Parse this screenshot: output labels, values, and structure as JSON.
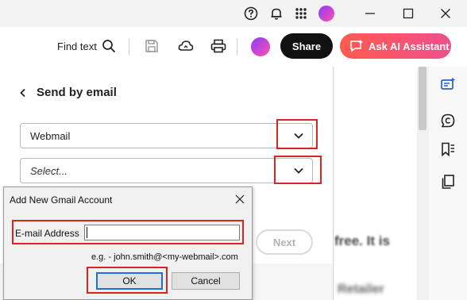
{
  "titlebar": {
    "icons": [
      "help-icon",
      "bell-icon",
      "apps-grid-icon",
      "avatar",
      "minimize-icon",
      "maximize-icon",
      "close-icon"
    ]
  },
  "toolbar": {
    "find_label": "Find text",
    "share_label": "Share",
    "ai_label": "Ask AI Assistant",
    "icons": [
      "search-icon",
      "save-icon",
      "cloud-icon",
      "print-icon"
    ],
    "colors": {
      "share_bg": "#111111",
      "ai_gradient_start": "#ff5a4e",
      "ai_gradient_end": "#ee4f8c"
    }
  },
  "panel": {
    "title": "Send by email",
    "provider_value": "Webmail",
    "account_placeholder": "Select...",
    "next_label": "Next"
  },
  "document": {
    "blur_line1": "free. It is",
    "blur_line2": "Retailer"
  },
  "dialog": {
    "title": "Add New Gmail Account",
    "email_label": "E-mail Address",
    "email_value": "",
    "hint": "e.g. - john.smith@<my-webmail>.com",
    "ok_label": "OK",
    "cancel_label": "Cancel"
  },
  "highlight_color": "#dd2222"
}
